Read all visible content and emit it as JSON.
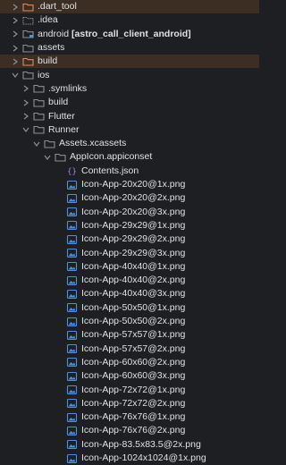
{
  "tree": {
    "dart_tool": ".dart_tool",
    "idea": ".idea",
    "android": "android",
    "android_module": "[astro_call_client_android]",
    "assets": "assets",
    "build": "build",
    "ios": "ios",
    "symlinks": ".symlinks",
    "ios_build": "build",
    "flutter": "Flutter",
    "runner": "Runner",
    "xcassets": "Assets.xcassets",
    "appiconset": "AppIcon.appiconset",
    "contents_json": "Contents.json",
    "files": [
      "Icon-App-20x20@1x.png",
      "Icon-App-20x20@2x.png",
      "Icon-App-20x20@3x.png",
      "Icon-App-29x29@1x.png",
      "Icon-App-29x29@2x.png",
      "Icon-App-29x29@3x.png",
      "Icon-App-40x40@1x.png",
      "Icon-App-40x40@2x.png",
      "Icon-App-40x40@3x.png",
      "Icon-App-50x50@1x.png",
      "Icon-App-50x50@2x.png",
      "Icon-App-57x57@1x.png",
      "Icon-App-57x57@2x.png",
      "Icon-App-60x60@2x.png",
      "Icon-App-60x60@3x.png",
      "Icon-App-72x72@1x.png",
      "Icon-App-72x72@2x.png",
      "Icon-App-76x76@1x.png",
      "Icon-App-76x76@2x.png",
      "Icon-App-83.5x83.5@2x.png",
      "Icon-App-1024x1024@1x.png"
    ]
  },
  "colors": {
    "background": "#1e1f22",
    "excluded_highlight": "#3d2e24",
    "folder": "#8c8f94",
    "excluded_folder": "#e08a5e",
    "image_icon": "#4a8fe0",
    "json_icon": "#a87ee8"
  },
  "icons": {
    "folder": "folder-icon",
    "excluded_folder": "excluded-folder-icon",
    "module_folder": "module-folder-icon",
    "image_file": "image-file-icon",
    "json_file": "json-file-icon",
    "expand": "chevron-right-icon",
    "collapse": "chevron-down-icon"
  }
}
